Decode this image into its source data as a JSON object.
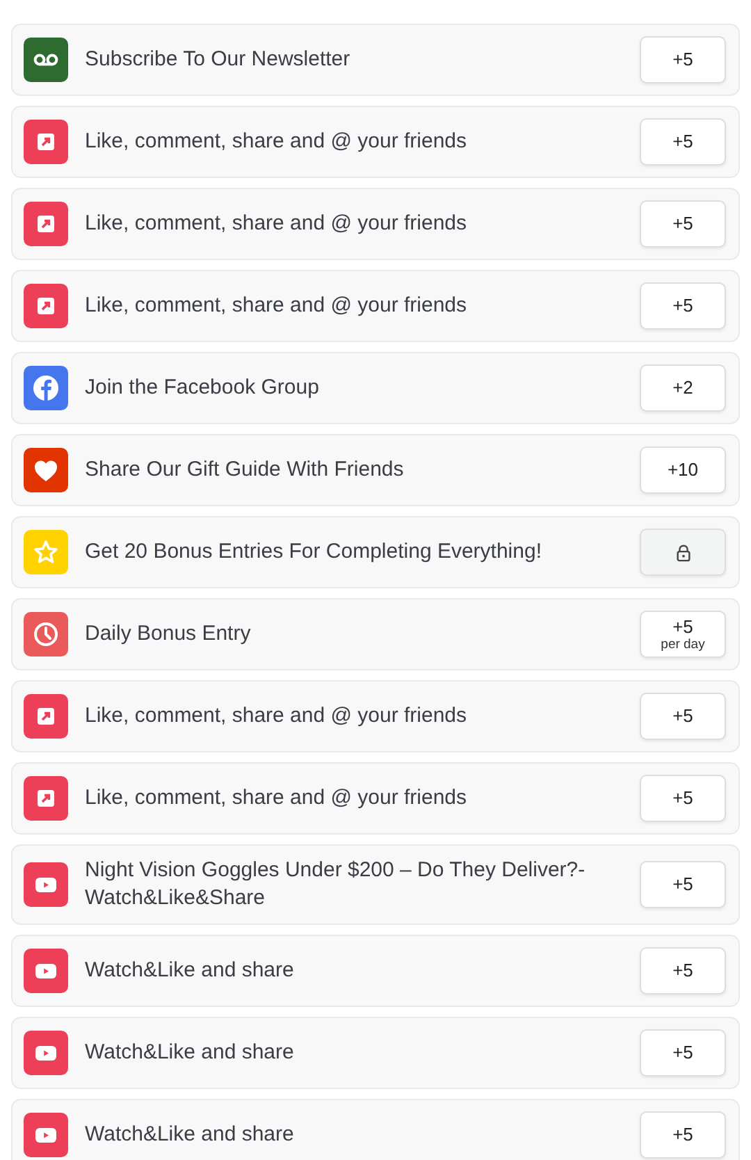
{
  "entries": [
    {
      "kind": "voicemail",
      "color": "#2e6b30",
      "label": "Subscribe To Our Newsletter",
      "points": "+5",
      "locked": false
    },
    {
      "kind": "share",
      "color": "#ee3f58",
      "label": "Like, comment, share and @ your friends",
      "points": "+5",
      "locked": false
    },
    {
      "kind": "share",
      "color": "#ee3f58",
      "label": "Like, comment, share and @ your friends",
      "points": "+5",
      "locked": false
    },
    {
      "kind": "share",
      "color": "#ee3f58",
      "label": "Like, comment, share and @ your friends",
      "points": "+5",
      "locked": false
    },
    {
      "kind": "facebook",
      "color": "#4676ed",
      "label": "Join the Facebook Group",
      "points": "+2",
      "locked": false
    },
    {
      "kind": "heart",
      "color": "#e23400",
      "label": "Share Our Gift Guide With Friends",
      "points": "+10",
      "locked": false
    },
    {
      "kind": "star",
      "color": "#ffd200",
      "label": "Get 20 Bonus Entries For Completing Everything!",
      "locked": true
    },
    {
      "kind": "clock",
      "color": "#ea5a5a",
      "label": "Daily Bonus Entry",
      "points": "+5",
      "note": "per day",
      "locked": false
    },
    {
      "kind": "share",
      "color": "#ee3f58",
      "label": "Like, comment, share and @ your friends",
      "points": "+5",
      "locked": false
    },
    {
      "kind": "share",
      "color": "#ee3f58",
      "label": "Like, comment, share and @ your friends",
      "points": "+5",
      "locked": false
    },
    {
      "kind": "youtube",
      "color": "#ee3f58",
      "label": "Night Vision Goggles Under $200 – Do They Deliver?- Watch&Like&Share",
      "points": "+5",
      "locked": false
    },
    {
      "kind": "youtube",
      "color": "#ee3f58",
      "label": "Watch&Like and share",
      "points": "+5",
      "locked": false
    },
    {
      "kind": "youtube",
      "color": "#ee3f58",
      "label": "Watch&Like and share",
      "points": "+5",
      "locked": false
    },
    {
      "kind": "youtube",
      "color": "#ee3f58",
      "label": "Watch&Like and share",
      "points": "+5",
      "locked": false
    }
  ]
}
